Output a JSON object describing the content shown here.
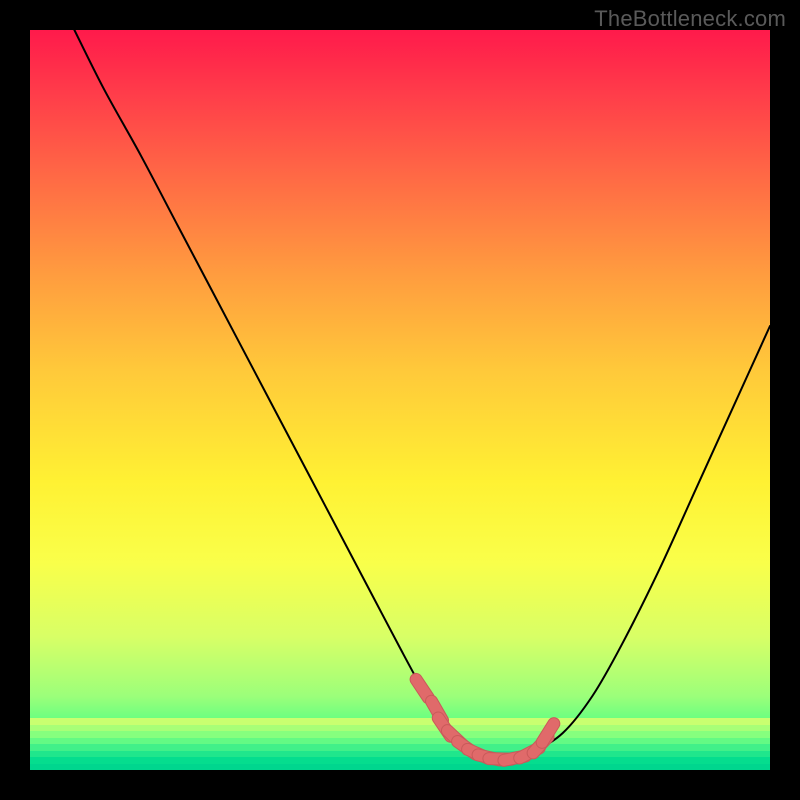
{
  "watermark": "TheBottleneck.com",
  "colors": {
    "frame": "#000000",
    "curve_stroke": "#000000",
    "marker_fill": "#e06a6a",
    "marker_stroke": "#c95a5a"
  },
  "chart_data": {
    "type": "line",
    "title": "",
    "xlabel": "",
    "ylabel": "",
    "xlim": [
      0,
      100
    ],
    "ylim": [
      0,
      100
    ],
    "grid": false,
    "legend": false,
    "series": [
      {
        "name": "bottleneck-curve",
        "x": [
          6,
          10,
          15,
          20,
          25,
          30,
          35,
          40,
          45,
          50,
          53,
          55,
          57,
          59,
          61,
          63,
          65,
          68,
          72,
          76,
          80,
          85,
          90,
          95,
          100
        ],
        "y": [
          100,
          92,
          83,
          73.5,
          64,
          54.5,
          45,
          35.5,
          26,
          16.5,
          11,
          8,
          5,
          3,
          2,
          1.5,
          1.5,
          2.5,
          5,
          10,
          17,
          27,
          38,
          49,
          60
        ]
      }
    ],
    "markers": {
      "name": "bottom-plateau",
      "points": [
        {
          "x": 53,
          "y": 11
        },
        {
          "x": 55,
          "y": 8
        },
        {
          "x": 56,
          "y": 5.8
        },
        {
          "x": 57.5,
          "y": 4.3
        },
        {
          "x": 59,
          "y": 3
        },
        {
          "x": 60.5,
          "y": 2.2
        },
        {
          "x": 62,
          "y": 1.7
        },
        {
          "x": 63.5,
          "y": 1.5
        },
        {
          "x": 65.5,
          "y": 1.6
        },
        {
          "x": 67.5,
          "y": 2.3
        },
        {
          "x": 69,
          "y": 3.4
        },
        {
          "x": 70,
          "y": 5
        }
      ]
    }
  }
}
